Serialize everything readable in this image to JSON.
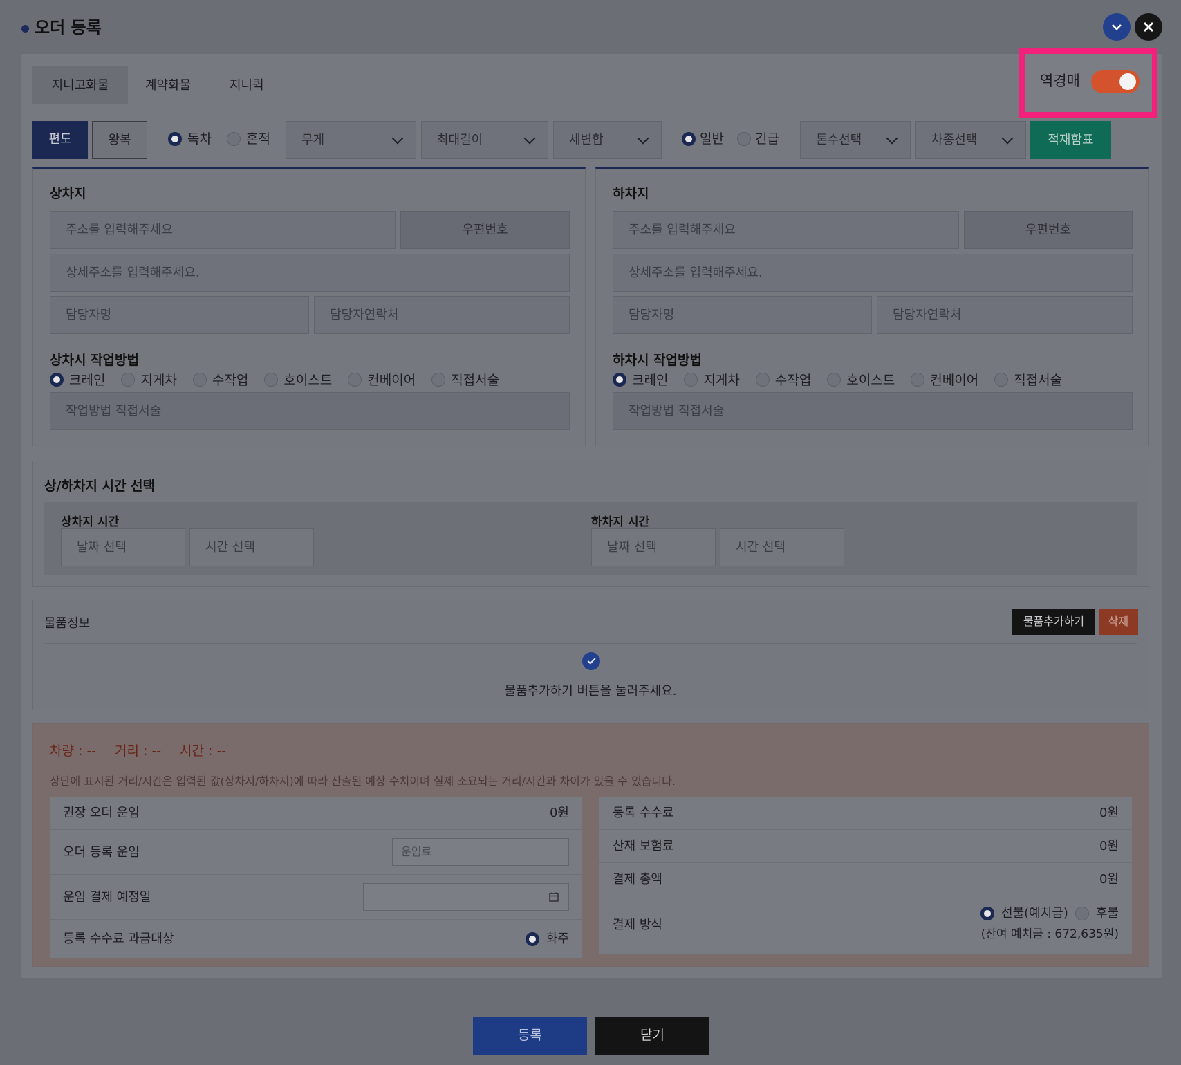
{
  "header": {
    "title": "오더 등록"
  },
  "tabs": [
    "지니고화물",
    "계약화물",
    "지니퀵"
  ],
  "reverse_auction": {
    "label": "역경매",
    "on": true
  },
  "toolbar": {
    "trip_one": "편도",
    "trip_round": "왕복",
    "load_type": [
      "독차",
      "혼적"
    ],
    "weight": "무게",
    "max_length": "최대길이",
    "variant": "세변합",
    "urgency": [
      "일반",
      "긴급"
    ],
    "tonnage": "톤수선택",
    "vehicle_type": "차종선택",
    "load_table": "적재함표"
  },
  "pickup": {
    "title": "상차지",
    "address_placeholder": "주소를 입력해주세요",
    "zip_button": "우편번호",
    "detail_placeholder": "상세주소를 입력해주세요.",
    "contact_name": "담당자명",
    "contact_phone": "담당자연락처",
    "method_title": "상차시 작업방법",
    "methods": [
      "크레인",
      "지게차",
      "수작업",
      "호이스트",
      "컨베이어",
      "직접서술"
    ],
    "method_placeholder": "작업방법 직접서술"
  },
  "dropoff": {
    "title": "하차지",
    "address_placeholder": "주소를 입력해주세요",
    "zip_button": "우편번호",
    "detail_placeholder": "상세주소를 입력해주세요.",
    "contact_name": "담당자명",
    "contact_phone": "담당자연락처",
    "method_title": "하차시 작업방법",
    "methods": [
      "크레인",
      "지게차",
      "수작업",
      "호이스트",
      "컨베이어",
      "직접서술"
    ],
    "method_placeholder": "작업방법 직접서술"
  },
  "time": {
    "title": "상/하차지 시간 선택",
    "pickup_label": "상차지 시간",
    "dropoff_label": "하차지 시간",
    "date_placeholder": "날짜 선택",
    "time_placeholder": "시간 선택"
  },
  "goods": {
    "title": "물품정보",
    "add_button": "물품추가하기",
    "delete_button": "삭제",
    "empty_message": "물품추가하기 버튼을 눌러주세요."
  },
  "fare": {
    "vehicle": "차량 : --",
    "distance": "거리 : --",
    "duration": "시간 : --",
    "note": "상단에 표시된 거리/시간은 입력된 값(상차지/하차지)에 따라 산출된 예상 수치이며 실제 소요되는 거리/시간과 차이가 있을 수 있습니다.",
    "recommended_label": "권장 오더 운임",
    "recommended_value": "0원",
    "order_fare_label": "오더 등록 운임",
    "order_fare_placeholder": "운임료",
    "pay_date_label": "운임 결제 예정일",
    "fee_target_label": "등록 수수료 과금대상",
    "fee_target_value": "화주",
    "reg_fee_label": "등록 수수료",
    "reg_fee_value": "0원",
    "insurance_label": "산재 보험료",
    "insurance_value": "0원",
    "total_label": "결제 총액",
    "total_value": "0원",
    "method_label": "결제 방식",
    "prepaid": "선불(예치금)",
    "postpaid": "후불",
    "balance": "(잔여 예치금 : 672,635원)"
  },
  "footer": {
    "submit": "등록",
    "close": "닫기"
  },
  "colors": {
    "navy": "#1b2852",
    "accent_blue": "#23408e",
    "teal": "#0f6b55",
    "toggle_on": "#d4532c",
    "highlight": "#f4217c"
  }
}
